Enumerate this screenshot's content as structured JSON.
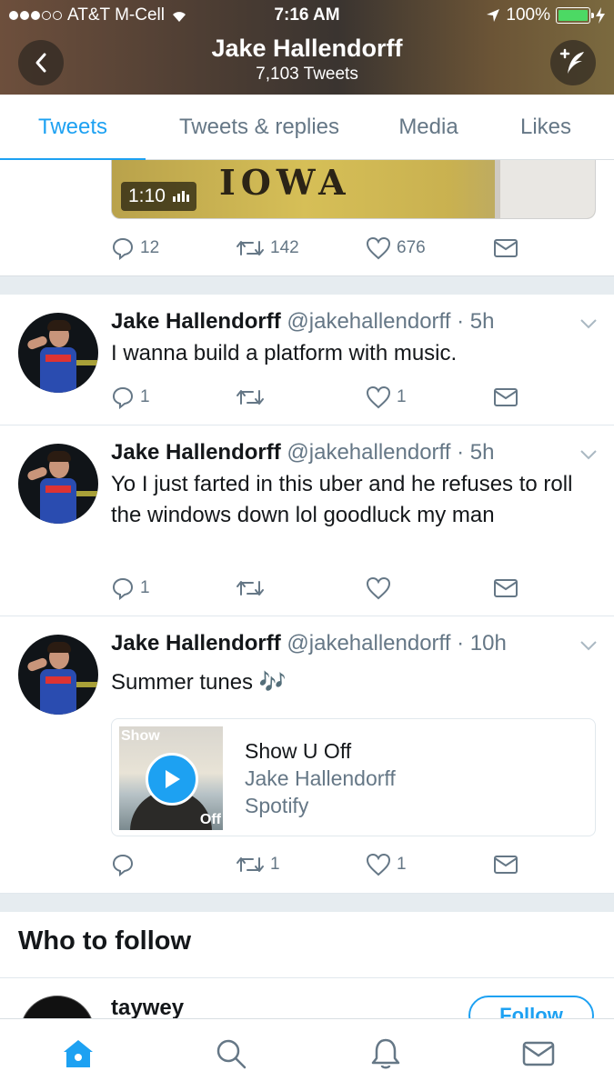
{
  "status_bar": {
    "carrier": "AT&T M-Cell",
    "time": "7:16 AM",
    "battery": "100%"
  },
  "header": {
    "title": "Jake Hallendorff",
    "subtitle": "7,103 Tweets"
  },
  "tabs": [
    {
      "label": "Tweets",
      "active": true
    },
    {
      "label": "Tweets & replies"
    },
    {
      "label": "Media"
    },
    {
      "label": "Likes"
    }
  ],
  "prev_tweet": {
    "video_duration": "1:10",
    "video_overlay_text": "IOWA",
    "replies": "12",
    "retweets": "142",
    "likes": "676"
  },
  "tweets": [
    {
      "name": "Jake Hallendorff",
      "handle": "@jakehallendorff",
      "time": "5h",
      "text": "I wanna build a platform with music.",
      "replies": "1",
      "retweets": "",
      "likes": "1"
    },
    {
      "name": "Jake Hallendorff",
      "handle": "@jakehallendorff",
      "time": "5h",
      "text": "Yo I just farted in this uber and he refuses to roll the windows down lol goodluck my man",
      "replies": "1",
      "retweets": "",
      "likes": ""
    },
    {
      "name": "Jake Hallendorff",
      "handle": "@jakehallendorff",
      "time": "10h",
      "text": "Summer tunes 🎶",
      "replies": "",
      "retweets": "1",
      "likes": "1",
      "card": {
        "title": "Show U Off",
        "artist": "Jake Hallendorff",
        "source": "Spotify",
        "art_top": "Show",
        "art_bottom": "Off"
      }
    }
  ],
  "who_to_follow": {
    "title": "Who to follow",
    "name": "taywey",
    "button": "Follow"
  },
  "colors": {
    "accent": "#1da1f2",
    "secondary_text": "#657786"
  }
}
